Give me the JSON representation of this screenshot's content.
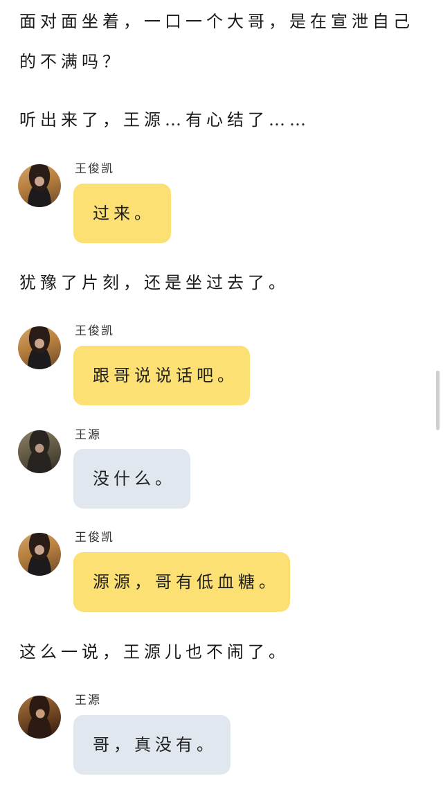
{
  "narration": [
    "面对面坐着，一口一个大哥，是在宣泄自己的不满吗？",
    "听出来了，王源…有心结了……",
    "犹豫了片刻，还是坐过去了。",
    "这么一说，王源儿也不闹了。"
  ],
  "messages": [
    {
      "speaker": "王俊凯",
      "text": "过来。",
      "avatar_icon": "avatar-wang-junkai",
      "bubble_color": "#fde073"
    },
    {
      "speaker": "王俊凯",
      "text": "跟哥说说话吧。",
      "avatar_icon": "avatar-wang-junkai",
      "bubble_color": "#fde073"
    },
    {
      "speaker": "王源",
      "text": "没什么。",
      "avatar_icon": "avatar-wang-yuan",
      "bubble_color": "#e1e7ef"
    },
    {
      "speaker": "王俊凯",
      "text": "源源，哥有低血糖。",
      "avatar_icon": "avatar-wang-junkai",
      "bubble_color": "#fde073"
    },
    {
      "speaker": "王源",
      "text": "哥，真没有。",
      "avatar_icon": "avatar-wang-yuan",
      "bubble_color": "#e1e7ef"
    }
  ],
  "colors": {
    "bubble_yellow": "#fde073",
    "bubble_grey": "#e1e7ef",
    "text": "#1f1f1f",
    "background": "#ffffff"
  }
}
